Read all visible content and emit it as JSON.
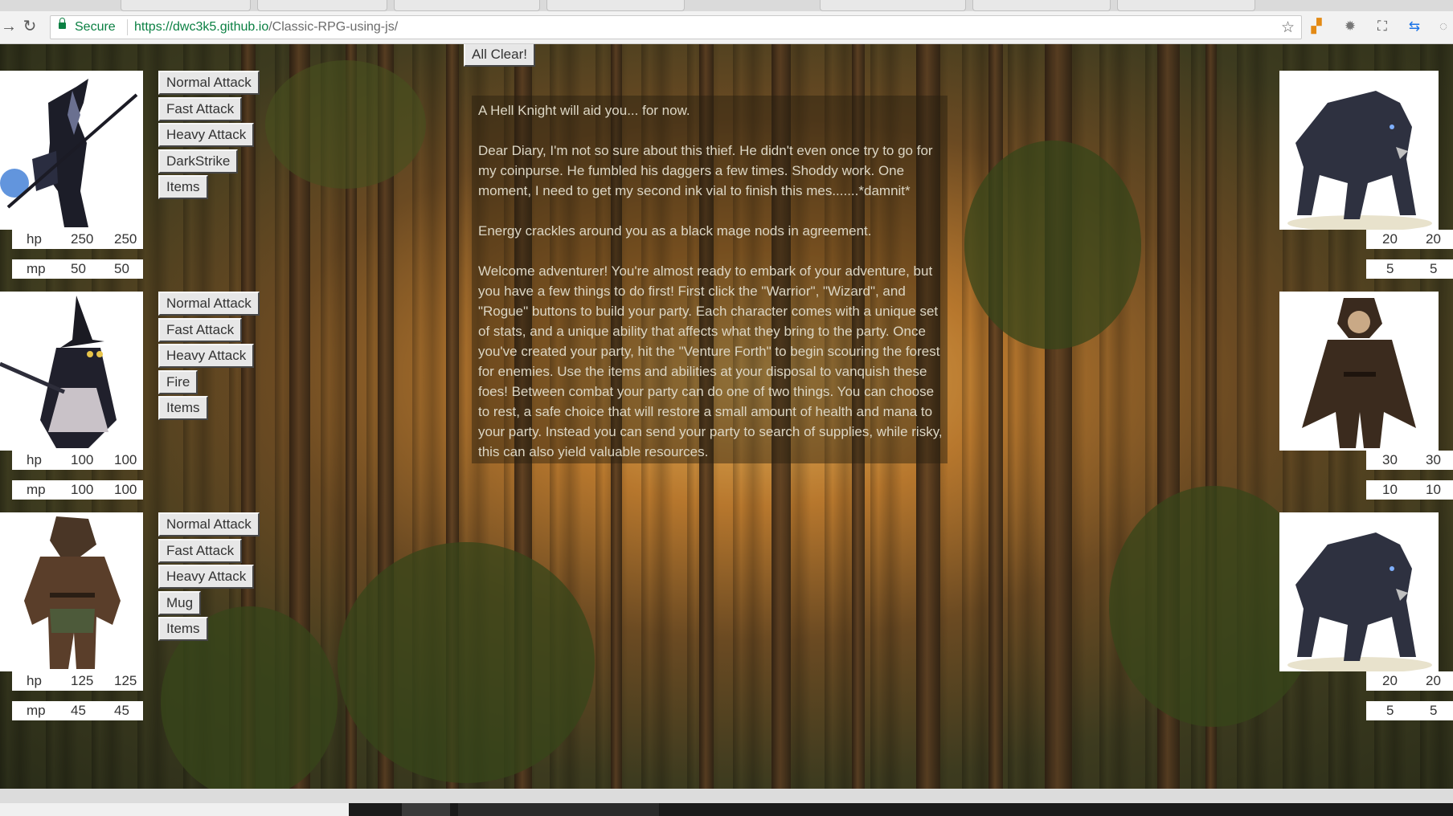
{
  "browser": {
    "secure_label": "Secure",
    "url_host": "https://dwc3k5.github.io",
    "url_path": "/Classic-RPG-using-js/"
  },
  "controls": {
    "all_clear_label": "All Clear!"
  },
  "party": [
    {
      "name": "hell-knight",
      "hp_label": "hp",
      "hp_current": "250",
      "hp_max": "250",
      "mp_label": "mp",
      "mp_current": "50",
      "mp_max": "50",
      "actions": [
        "Normal Attack",
        "Fast Attack",
        "Heavy Attack",
        "DarkStrike",
        "Items"
      ]
    },
    {
      "name": "black-mage",
      "hp_label": "hp",
      "hp_current": "100",
      "hp_max": "100",
      "mp_label": "mp",
      "mp_current": "100",
      "mp_max": "100",
      "actions": [
        "Normal Attack",
        "Fast Attack",
        "Heavy Attack",
        "Fire",
        "Items"
      ]
    },
    {
      "name": "thief",
      "hp_label": "hp",
      "hp_current": "125",
      "hp_max": "125",
      "mp_label": "mp",
      "mp_current": "45",
      "mp_max": "45",
      "actions": [
        "Normal Attack",
        "Fast Attack",
        "Heavy Attack",
        "Mug",
        "Items"
      ]
    }
  ],
  "enemies": [
    {
      "name": "wolf",
      "hp_current": "20",
      "hp_max": "20",
      "mp_current": "5",
      "mp_max": "5"
    },
    {
      "name": "bandit",
      "hp_current": "30",
      "hp_max": "30",
      "mp_current": "10",
      "mp_max": "10"
    },
    {
      "name": "wolf",
      "hp_current": "20",
      "hp_max": "20",
      "mp_current": "5",
      "mp_max": "5"
    }
  ],
  "log": [
    "A Hell Knight will aid you... for now.",
    "Dear Diary, I'm not so sure about this thief. He didn't even once try to go for my coinpurse. He fumbled his daggers a few times. Shoddy work. One moment, I need to get my second ink vial to finish this mes.......*damnit*",
    "Energy crackles around you as a black mage nods in agreement.",
    "Welcome adventurer! You're almost ready to embark of your adventure, but you have a few things to do first! First click the \"Warrior\", \"Wizard\", and \"Rogue\" buttons to build your party. Each character comes with a unique set of stats, and a unique ability that affects what they bring to the party. Once you've created your party, hit the \"Venture Forth\" to begin scouring the forest for enemies. Use the items and abilities at your disposal to vanquish these foes! Between combat your party can do one of two things. You can choose to rest, a safe choice that will restore a small amount of health and mana to your party. Instead you can send your party to search of supplies, while risky, this can also yield valuable resources."
  ]
}
